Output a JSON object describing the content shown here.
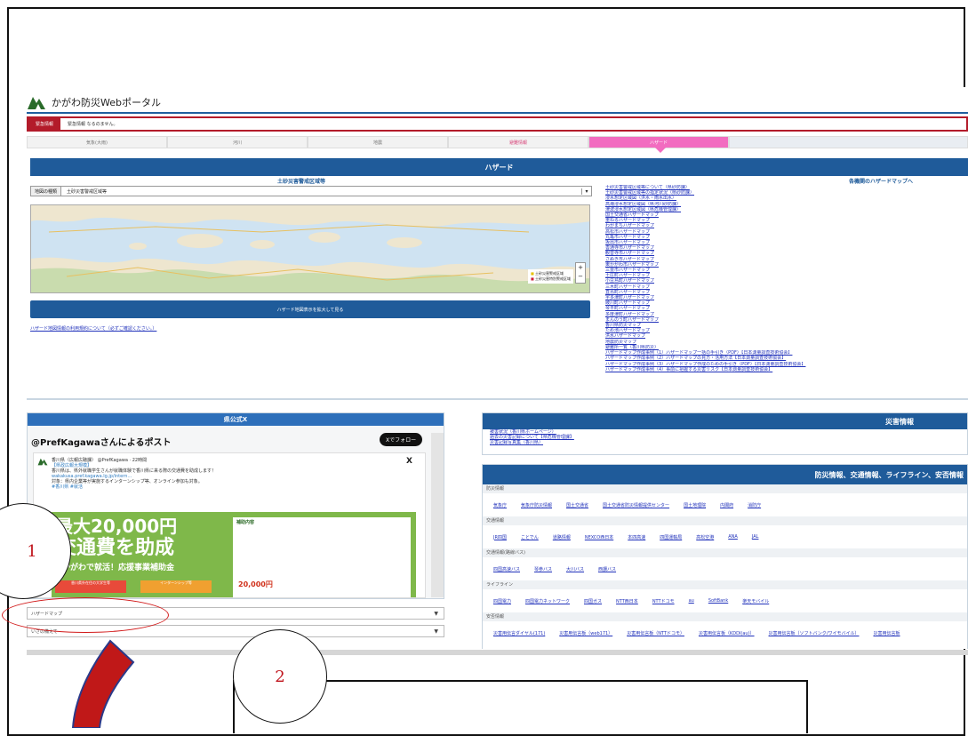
{
  "portal": {
    "title": "かがわ防災Webポータル",
    "alert_label": "緊急情報",
    "alert_text": "緊急情報 なるのません。",
    "tabs": [
      "気象(大雨)",
      "河川",
      "地震",
      "避難情報",
      "ハザード"
    ],
    "hazard_title": "ハザード",
    "left_subtitle": "土砂災害警戒区域等",
    "right_subtitle": "各機関のハザードマップへ",
    "select_label": "地図の種類",
    "select_value": "土砂災害警戒区域等",
    "legend": [
      "土砂災害警戒区域",
      "土砂災害特別警戒区域"
    ],
    "expand_button": "ハザード地図表示を拡大して見る",
    "note_link": "ハザード地図情報の利用規約について（必ずご確認ください。）",
    "hazard_links": [
      "土砂災害警戒区域等について（県砂防課）",
      "土砂災害警戒区域等の指定状況（県砂防課）",
      "浸水想定区域図（洪水・雨水出水）",
      "高潮浸水想定区域図（県河川砂防課）",
      "津波浸水想定区域図（県危機管理課）",
      "国土交通省ハザードマップ",
      "重ねるハザードマップ",
      "わがまちハザードマップ",
      "高松市ハザードマップ",
      "丸亀市ハザードマップ",
      "坂出市ハザードマップ",
      "善通寺市ハザードマップ",
      "観音寺市ハザードマップ",
      "さぬき市ハザードマップ",
      "東かがわ市ハザードマップ",
      "三豊市ハザードマップ",
      "土庄町ハザードマップ",
      "小豆島町ハザードマップ",
      "三木町ハザードマップ",
      "直島町ハザードマップ",
      "宇多津町ハザードマップ",
      "綾川町ハザードマップ",
      "琴平町ハザードマップ",
      "多度津町ハザードマップ",
      "まんのう町ハザードマップ",
      "香川県防災マップ",
      "ため池ハザードマップ",
      "洪水ハザードマップ",
      "地震防災マップ",
      "避難所一覧（香川県防災）",
      "ハザードマップ作成事例（1）ハザードマップ一括の手引き（PDF）【日本測量調査技術協会】",
      "ハザードマップ作成事例（2）ハザードマップの見方・活用方法【日本測量調査技術協会】",
      "ハザードマップ作成事例（3）ハザードマップ作成のための手引き（PDF）【日本測量調査技術協会】",
      "ハザードマップ作成事例（4）事前に把握する災害リスク【日本測量調査技術協会】"
    ]
  },
  "x_panel": {
    "header": "県公式X",
    "title": "@PrefKagawaさんによるポスト",
    "follow": "Xでフォロー",
    "author": "香川県（広報広聴課） @PrefKagawa · 22時間",
    "tag": "【県政広報大規模】",
    "body1": "香川県は、県外就職学生さんが就職体験で香川県に来る際の交通費を助成します！",
    "link": "wakakusa.pref.kagawa.lg.jp/intern…",
    "body2": "対象：県内企業等が実施するインターンシップ等、オンライン参加も対象。",
    "hashtags": "#香川県 #就活",
    "img_line1": "最大20,000円",
    "img_line2": "交通費を助成",
    "img_sub": "かがわで就活！応援事業補助金",
    "img_badge1": "香川県外在住の大学生等",
    "img_badge2": "インターンシップ等",
    "img_doc_head": "補助内容",
    "img_price": "20,000円"
  },
  "dropdowns": [
    "ハザードマップ",
    "いざの備えて"
  ],
  "disaster": {
    "header": "災害情報",
    "links": [
      "被害状況（香川県ホームページ）",
      "過去の災害記録について【県危機管理課】",
      "災害記録写真集（香川県）"
    ]
  },
  "info": {
    "header": "防災情報、交通情報、ライフライン、安否情報",
    "categories": [
      {
        "name": "防災情報",
        "links": [
          "気象庁",
          "気象庁防災情報",
          "国土交通省",
          "国土交通省防災情報提供センター",
          "国土地理院",
          "内閣府",
          "消防庁"
        ]
      },
      {
        "name": "交通情報",
        "links": [
          "JR四国",
          "ことでん",
          "道路情報",
          "NEXCO西日本",
          "本四高速",
          "四国運輸局",
          "高松空港",
          "ANA",
          "JAL"
        ]
      },
      {
        "name": "交通情報(路線バス)",
        "links": [
          "四国高速バス",
          "琴参バス",
          "大川バス",
          "西讃バス"
        ]
      },
      {
        "name": "ライフライン",
        "links": [
          "四国電力",
          "四国電力ネットワーク",
          "四国ガス",
          "NTT西日本",
          "NTTドコモ",
          "au",
          "SoftBank",
          "楽天モバイル"
        ]
      },
      {
        "name": "安否情報",
        "links": [
          "災害用伝言ダイヤル(171)",
          "災害用伝言板（web171）",
          "災害用伝言板（NTTドコモ）",
          "災害用伝言板（KDDI(au)）",
          "災害用伝言板（ソフトバンク/ワイモバイル）",
          "災害用伝言板"
        ]
      }
    ]
  },
  "annotations": {
    "label1": "1",
    "label2": "2"
  },
  "colors": {
    "navy": "#1f5b9a",
    "pink": "#f26cc0",
    "alert_red": "#b31b2a",
    "annotation_red": "#c0141c"
  }
}
